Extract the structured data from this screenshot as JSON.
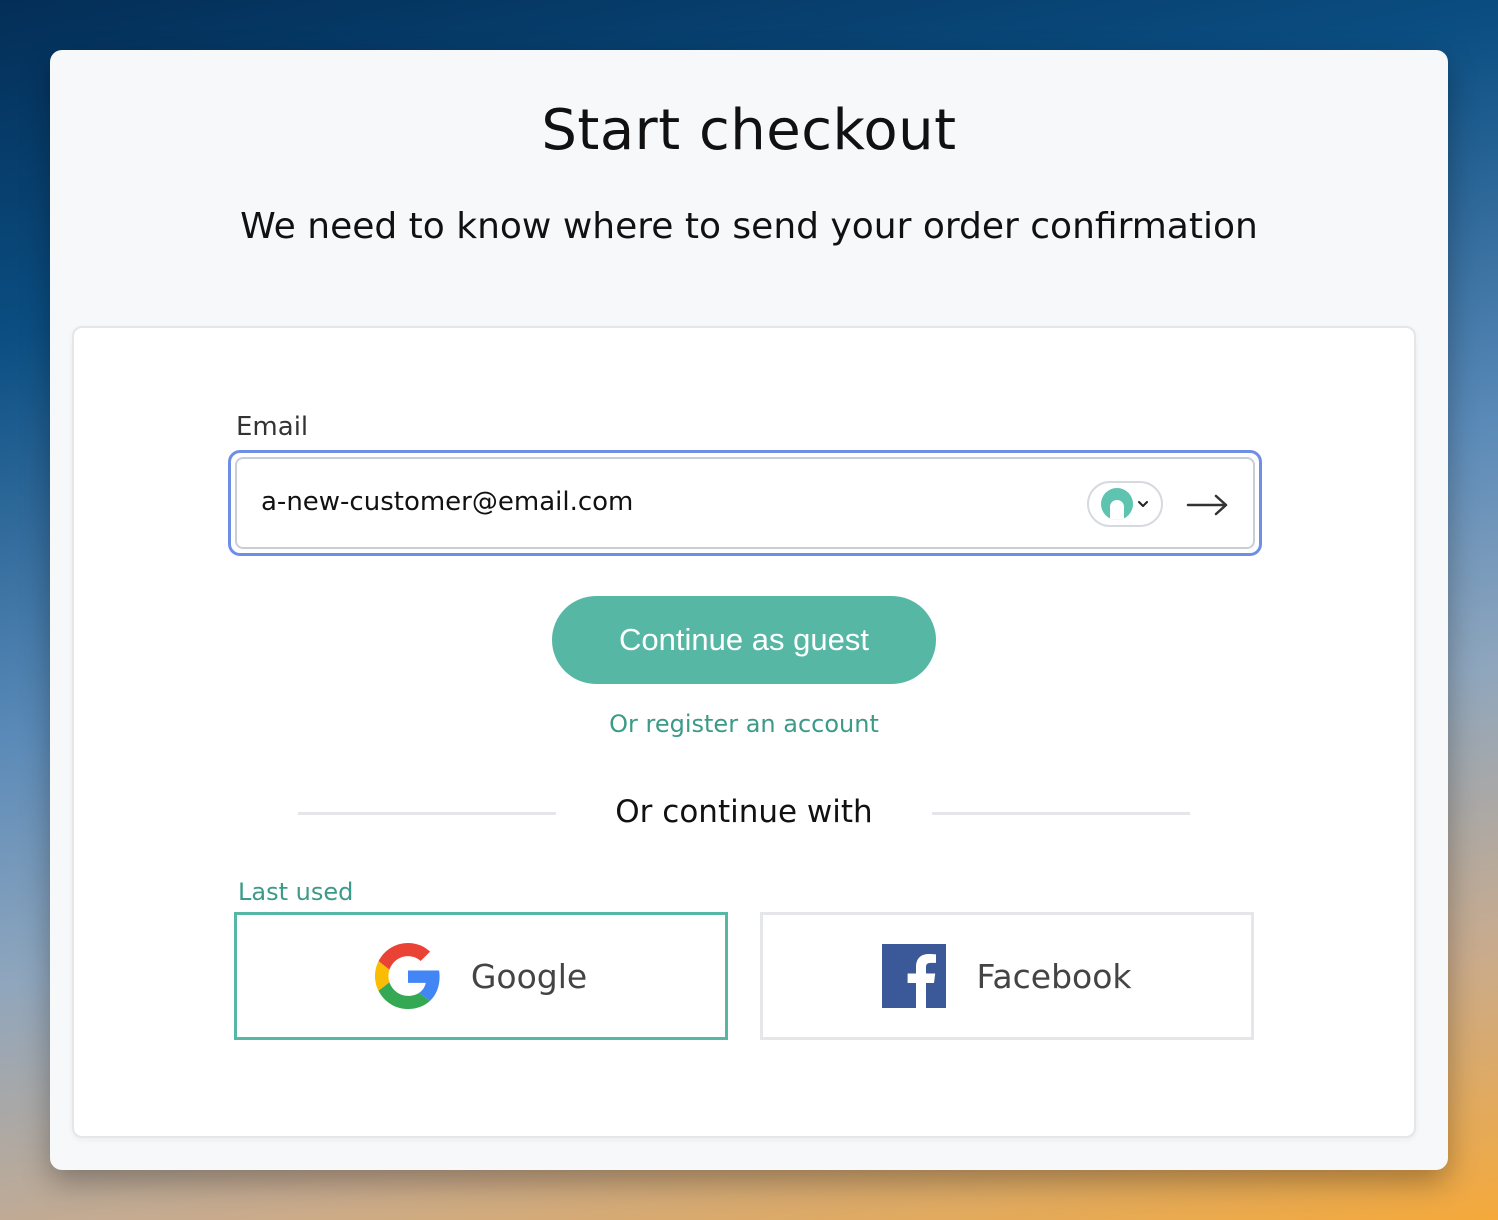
{
  "page": {
    "title": "Start checkout",
    "subtitle": "We need to know where to send your order confirmation"
  },
  "form": {
    "email_label": "Email",
    "email_value": "a-new-customer@email.com",
    "email_type": "email"
  },
  "actions": {
    "guest_label": "Continue as guest",
    "register_label": "Or register an account"
  },
  "social": {
    "divider_label": "Or continue with",
    "last_used_label": "Last used",
    "google_label": "Google",
    "facebook_label": "Facebook"
  },
  "icons": {
    "password_manager": "password-manager-icon",
    "submit": "arrow-right-icon",
    "google": "google-g-icon",
    "facebook": "facebook-f-icon"
  },
  "colors": {
    "accent": "#57b7a5",
    "link": "#3c9a88",
    "focus_ring": "#6f8ee6",
    "facebook_blue": "#3b5998"
  }
}
